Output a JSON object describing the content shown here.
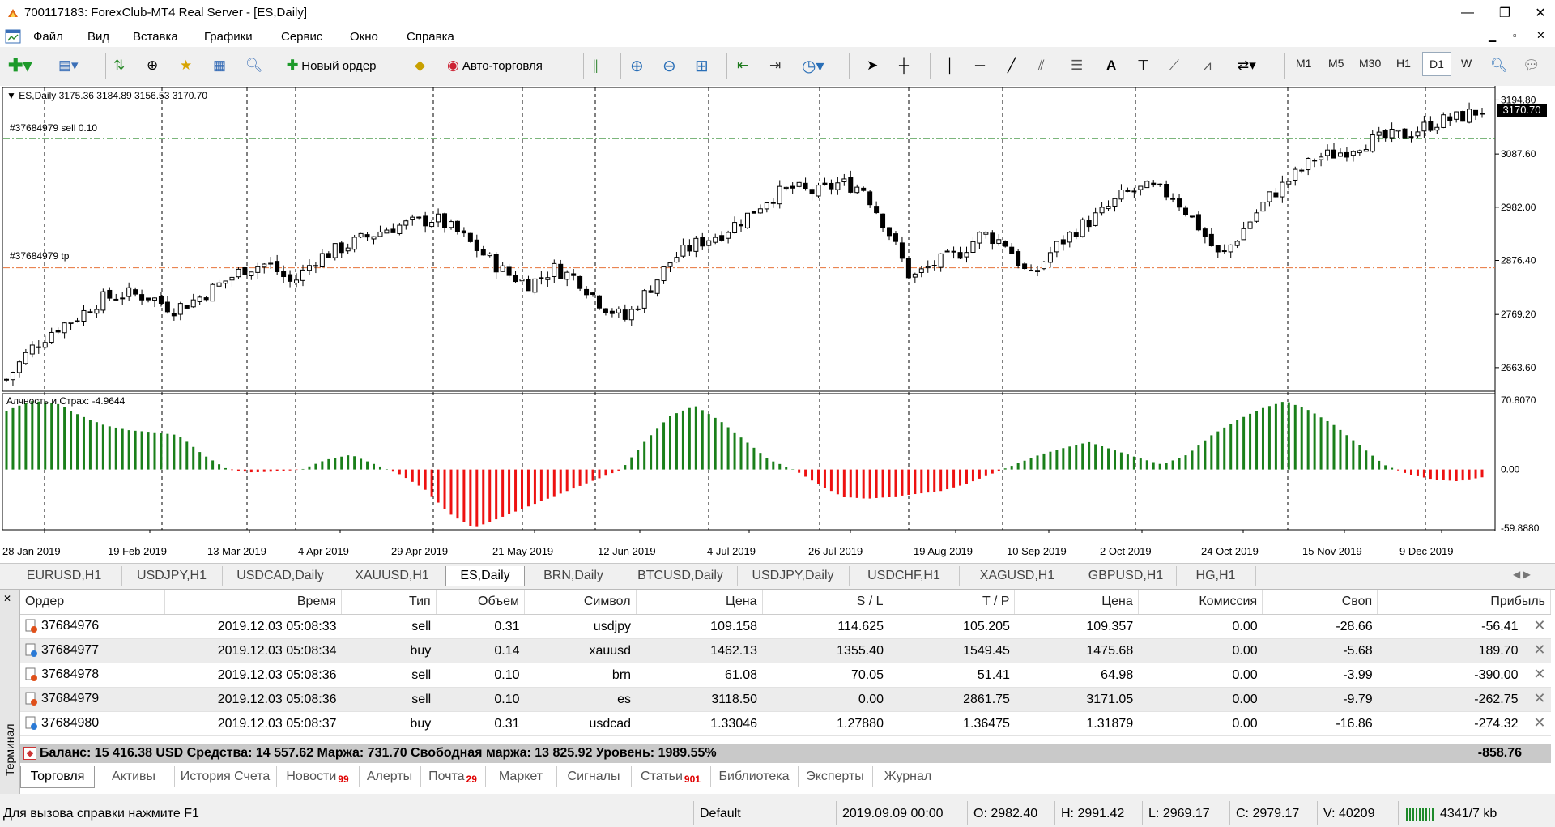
{
  "window": {
    "title": "700117183: ForexClub-MT4 Real Server - [ES,Daily]",
    "controls": {
      "minimize": "—",
      "restore": "❐",
      "close": "✕"
    }
  },
  "menu": [
    "Файл",
    "Вид",
    "Вставка",
    "Графики",
    "Сервис",
    "Окно",
    "Справка"
  ],
  "toolbar": {
    "new_order_label": "Новый ордер",
    "autotrade_label": "Авто-торговля",
    "timeframes": [
      "M1",
      "M5",
      "M30",
      "H1",
      "D1",
      "W"
    ],
    "active_timeframe": "D1"
  },
  "chart": {
    "symbol_header": "ES,Daily  3175.36 3184.89 3156.53 3170.70",
    "sell_label": "#37684979 sell 0.10",
    "tp_label": "#37684979 tp",
    "current_price": "3170.70",
    "price_ticks": [
      "3194.80",
      "3087.60",
      "2982.00",
      "2876.40",
      "2769.20",
      "2663.60"
    ],
    "indicator_label": "Алчность и Страх: -4.9644",
    "indicator_ticks": [
      "70.8070",
      "0.00",
      "-59.8880"
    ],
    "date_ticks": [
      "28 Jan 2019",
      "19 Feb 2019",
      "13 Mar 2019",
      "4 Apr 2019",
      "29 Apr 2019",
      "21 May 2019",
      "12 Jun 2019",
      "4 Jul 2019",
      "26 Jul 2019",
      "19 Aug 2019",
      "10 Sep 2019",
      "2 Oct 2019",
      "24 Oct 2019",
      "15 Nov 2019",
      "9 Dec 2019"
    ],
    "colors": {
      "bull_bar": "#1a7f1a",
      "bear_bar": "#ee1111",
      "sell_line": "#2e8b2e",
      "tp_line": "#e8743b"
    }
  },
  "chart_data": {
    "type": "candlestick",
    "title": "ES,Daily",
    "ylim": [
      2620,
      3210
    ],
    "levels": {
      "sell_open": 3118.5,
      "take_profit": 2861.75
    },
    "price_path": [
      2640,
      2700,
      2740,
      2765,
      2800,
      2810,
      2805,
      2780,
      2800,
      2830,
      2860,
      2870,
      2830,
      2880,
      2900,
      2920,
      2940,
      2950,
      2960,
      2930,
      2890,
      2850,
      2830,
      2860,
      2840,
      2790,
      2760,
      2820,
      2880,
      2910,
      2930,
      2960,
      3000,
      3020,
      3010,
      3030,
      3020,
      2940,
      2840,
      2870,
      2890,
      2930,
      2910,
      2840,
      2900,
      2940,
      2970,
      3010,
      3020,
      3005,
      2950,
      2880,
      2940,
      3000,
      3040,
      3080,
      3090,
      3110,
      3120,
      3130,
      3150,
      3160,
      3175
    ],
    "indicator_ylim": [
      -59.888,
      70.807
    ],
    "indicator_path": [
      60,
      70,
      68,
      55,
      45,
      40,
      38,
      35,
      15,
      0,
      -3,
      -2,
      0,
      10,
      15,
      5,
      -5,
      -20,
      -45,
      -60,
      -50,
      -40,
      -30,
      -20,
      -10,
      0,
      30,
      55,
      65,
      50,
      30,
      10,
      0,
      -15,
      -28,
      -30,
      -28,
      -25,
      -22,
      -15,
      -5,
      5,
      15,
      22,
      28,
      20,
      12,
      5,
      15,
      35,
      50,
      62,
      70,
      60,
      45,
      25,
      5,
      -5,
      -10,
      -12,
      -8
    ]
  },
  "symbol_tabs": [
    "EURUSD,H1",
    "USDJPY,H1",
    "USDCAD,Daily",
    "XAUUSD,H1",
    "ES,Daily",
    "BRN,Daily",
    "BTCUSD,Daily",
    "USDJPY,Daily",
    "USDCHF,H1",
    "XAGUSD,H1",
    "GBPUSD,H1",
    "HG,H1"
  ],
  "active_symbol_tab": "ES,Daily",
  "terminal": {
    "side_label": "Терминал",
    "columns": [
      "Ордер",
      "Время",
      "Тип",
      "Объем",
      "Символ",
      "Цена",
      "S / L",
      "T / P",
      "Цена",
      "Комиссия",
      "Своп",
      "Прибыль"
    ],
    "rows": [
      {
        "order": "37684976",
        "time": "2019.12.03 05:08:33",
        "type": "sell",
        "volume": "0.31",
        "symbol": "usdjpy",
        "price": "109.158",
        "sl": "114.625",
        "tp": "105.205",
        "cur": "109.357",
        "commission": "0.00",
        "swap": "-28.66",
        "profit": "-56.41"
      },
      {
        "order": "37684977",
        "time": "2019.12.03 05:08:34",
        "type": "buy",
        "volume": "0.14",
        "symbol": "xauusd",
        "price": "1462.13",
        "sl": "1355.40",
        "tp": "1549.45",
        "cur": "1475.68",
        "commission": "0.00",
        "swap": "-5.68",
        "profit": "189.70"
      },
      {
        "order": "37684978",
        "time": "2019.12.03 05:08:36",
        "type": "sell",
        "volume": "0.10",
        "symbol": "brn",
        "price": "61.08",
        "sl": "70.05",
        "tp": "51.41",
        "cur": "64.98",
        "commission": "0.00",
        "swap": "-3.99",
        "profit": "-390.00"
      },
      {
        "order": "37684979",
        "time": "2019.12.03 05:08:36",
        "type": "sell",
        "volume": "0.10",
        "symbol": "es",
        "price": "3118.50",
        "sl": "0.00",
        "tp": "2861.75",
        "cur": "3171.05",
        "commission": "0.00",
        "swap": "-9.79",
        "profit": "-262.75"
      },
      {
        "order": "37684980",
        "time": "2019.12.03 05:08:37",
        "type": "buy",
        "volume": "0.31",
        "symbol": "usdcad",
        "price": "1.33046",
        "sl": "1.27880",
        "tp": "1.36475",
        "cur": "1.31879",
        "commission": "0.00",
        "swap": "-16.86",
        "profit": "-274.32"
      }
    ],
    "balance_text": "Баланс: 15 416.38 USD  Средства: 14 557.62  Маржа: 731.70  Свободная маржа: 13 825.92  Уровень: 1989.55%",
    "total_profit": "-858.76",
    "tabs": [
      {
        "label": "Торговля",
        "badge": ""
      },
      {
        "label": "Активы",
        "badge": ""
      },
      {
        "label": "История Счета",
        "badge": ""
      },
      {
        "label": "Новости",
        "badge": "99"
      },
      {
        "label": "Алерты",
        "badge": ""
      },
      {
        "label": "Почта",
        "badge": "29"
      },
      {
        "label": "Маркет",
        "badge": ""
      },
      {
        "label": "Сигналы",
        "badge": ""
      },
      {
        "label": "Статьи",
        "badge": "901"
      },
      {
        "label": "Библиотека",
        "badge": ""
      },
      {
        "label": "Эксперты",
        "badge": ""
      },
      {
        "label": "Журнал",
        "badge": ""
      }
    ]
  },
  "status": {
    "help": "Для вызова справки нажмите F1",
    "profile": "Default",
    "datetime": "2019.09.09 00:00",
    "open": "O: 2982.40",
    "high": "H: 2991.42",
    "low": "L: 2969.17",
    "close": "C: 2979.17",
    "volume": "V: 40209",
    "traffic": "4341/7 kb"
  }
}
